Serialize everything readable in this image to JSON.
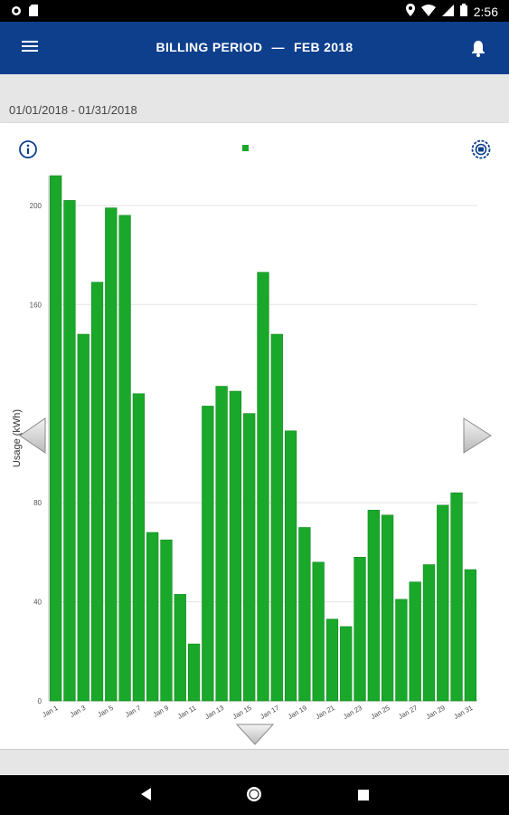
{
  "status_bar": {
    "time": "2:56"
  },
  "app_bar": {
    "title": "BILLING PERIOD",
    "separator": "—",
    "period": "FEB 2018"
  },
  "date_range": "01/01/2018 - 01/31/2018",
  "legend": {
    "label": "-"
  },
  "colors": {
    "primary": "#0d3f8c",
    "bar": "#1aa82a",
    "bar_stroke": "#128a20"
  },
  "icons": [
    "menu-icon",
    "bell-icon",
    "info-icon",
    "settings-icon",
    "chevron-left-icon",
    "chevron-right-icon",
    "chevron-down-icon"
  ],
  "chart_data": {
    "type": "bar",
    "ylabel": "Usage (kWh)",
    "ylim": [
      0,
      212
    ],
    "yticks": [
      0,
      40,
      80,
      160,
      200
    ],
    "categories": [
      "Jan 1",
      "Jan 2",
      "Jan 3",
      "Jan 4",
      "Jan 5",
      "Jan 6",
      "Jan 7",
      "Jan 8",
      "Jan 9",
      "Jan 10",
      "Jan 11",
      "Jan 12",
      "Jan 13",
      "Jan 14",
      "Jan 15",
      "Jan 16",
      "Jan 17",
      "Jan 18",
      "Jan 19",
      "Jan 20",
      "Jan 21",
      "Jan 22",
      "Jan 23",
      "Jan 24",
      "Jan 25",
      "Jan 26",
      "Jan 27",
      "Jan 28",
      "Jan 29",
      "Jan 30",
      "Jan 31"
    ],
    "xtick_labels": [
      "Jan 1",
      "Jan 3",
      "Jan 5",
      "Jan 7",
      "Jan 9",
      "Jan 11",
      "Jan 13",
      "Jan 15",
      "Jan 17",
      "Jan 19",
      "Jan 21",
      "Jan 23",
      "Jan 25",
      "Jan 27",
      "Jan 29",
      "Jan 31"
    ],
    "values": [
      212,
      202,
      148,
      169,
      199,
      196,
      124,
      68,
      65,
      43,
      23,
      119,
      127,
      125,
      116,
      173,
      148,
      109,
      70,
      56,
      33,
      30,
      58,
      77,
      75,
      41,
      48,
      55,
      79,
      84,
      53
    ],
    "grid": true
  }
}
